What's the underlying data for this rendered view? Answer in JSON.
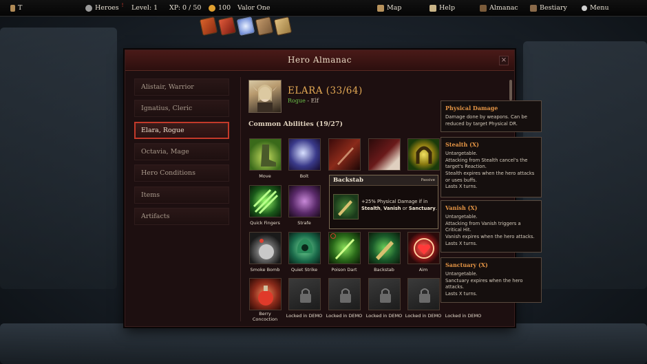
{
  "topbar": {
    "player_name": "T",
    "heroes_label": "Heroes",
    "level": "Level: 1",
    "xp": "XP: 0 / 50",
    "gold": "100",
    "party_name": "Valor One",
    "map_label": "Map",
    "help_label": "Help",
    "almanac_label": "Almanac",
    "bestiary_label": "Bestiary",
    "menu_label": "Menu"
  },
  "panel": {
    "title": "Hero Almanac",
    "close": "×"
  },
  "sidebar": {
    "items": [
      {
        "label": "Alistair, Warrior"
      },
      {
        "label": "Ignatius, Cleric"
      },
      {
        "label": "Elara, Rogue"
      },
      {
        "label": "Octavia, Mage"
      },
      {
        "label": "Hero Conditions"
      },
      {
        "label": "Items"
      },
      {
        "label": "Artifacts"
      }
    ],
    "active_index": 2
  },
  "hero": {
    "name": "ELARA (33/64)",
    "class": "Rogue",
    "separator": " - ",
    "race": "Elf"
  },
  "abilities": {
    "section_title": "Common Abilities (19/27)",
    "labels": {
      "move": "Move",
      "bolt": "Bolt",
      "quick_fingers": "Quick Fingers",
      "strafe": "Strafe",
      "smoke_bomb": "Smoke Bomb",
      "quiet_strike": "Quiet Strike",
      "poison_dart": "Poison Dart",
      "backstab": "Backstab",
      "aim": "Aim",
      "berry_line1": "Berry",
      "berry_line2": "Concoction",
      "locked": "Locked in DEMO"
    }
  },
  "tooltip": {
    "name": "Backstab",
    "tag": "Passive",
    "desc_pre": "+25% Physical Damage if in ",
    "kw1": "Stealth",
    "sep1": ", ",
    "kw2": "Vanish",
    "sep2": " or ",
    "kw3": "Sanctuary",
    "end": "."
  },
  "keywords": {
    "physical": {
      "title": "Physical Damage",
      "l1": "Damage done by weapons. Can be",
      "l2": "reduced by target Physical DR."
    },
    "stealth": {
      "title": "Stealth (X)",
      "l1": "Untargetable.",
      "l2": "Attacking from Stealth cancel's the",
      "l3": "target's Reaction.",
      "l4": "Stealth expires when the hero attacks",
      "l5": "or uses buffs.",
      "l6": "Lasts X turns."
    },
    "vanish": {
      "title": "Vanish (X)",
      "l1": "Untargetable.",
      "l2": "Attacking from Vanish triggers a",
      "l3": "Critical Hit.",
      "l4": "Vanish expires when the hero attacks.",
      "l5": "Lasts X turns."
    },
    "sanctuary": {
      "title": "Sanctuary (X)",
      "l1": "Untargetable.",
      "l2": "Sanctuary expires when the hero",
      "l3": "attacks.",
      "l4": "Lasts X turns."
    }
  }
}
